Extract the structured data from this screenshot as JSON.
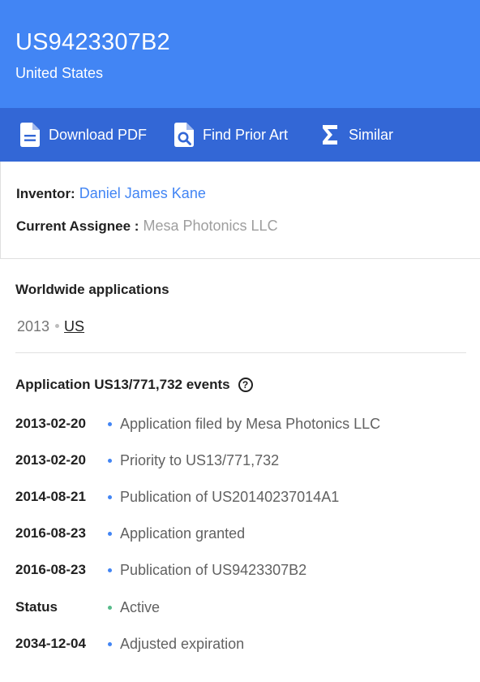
{
  "header": {
    "patent_number": "US9423307B2",
    "country": "United States",
    "background_color": "#4285f4"
  },
  "toolbar": {
    "background_color": "#3367d6",
    "download_pdf": "Download PDF",
    "find_prior_art": "Find Prior Art",
    "similar": "Similar"
  },
  "meta": {
    "inventor_label": "Inventor:",
    "inventor_name": "Daniel James Kane",
    "assignee_label": "Current Assignee :",
    "assignee_name": "Mesa Photonics LLC"
  },
  "worldwide": {
    "title": "Worldwide applications",
    "year": "2013",
    "country_link": "US"
  },
  "events": {
    "title": "Application US13/771,732 events",
    "help_icon": "help-circle-icon",
    "items": [
      {
        "date": "2013-02-20",
        "text": "Application filed by Mesa Photonics LLC",
        "dot_color": "#4285f4"
      },
      {
        "date": "2013-02-20",
        "text": "Priority to US13/771,732",
        "dot_color": "#4285f4"
      },
      {
        "date": "2014-08-21",
        "text": "Publication of US20140237014A1",
        "dot_color": "#4285f4"
      },
      {
        "date": "2016-08-23",
        "text": "Application granted",
        "dot_color": "#4285f4"
      },
      {
        "date": "2016-08-23",
        "text": "Publication of US9423307B2",
        "dot_color": "#4285f4"
      },
      {
        "date": "Status",
        "text": "Active",
        "dot_color": "#57bb8a"
      },
      {
        "date": "2034-12-04",
        "text": "Adjusted expiration",
        "dot_color": "#4285f4"
      }
    ]
  }
}
